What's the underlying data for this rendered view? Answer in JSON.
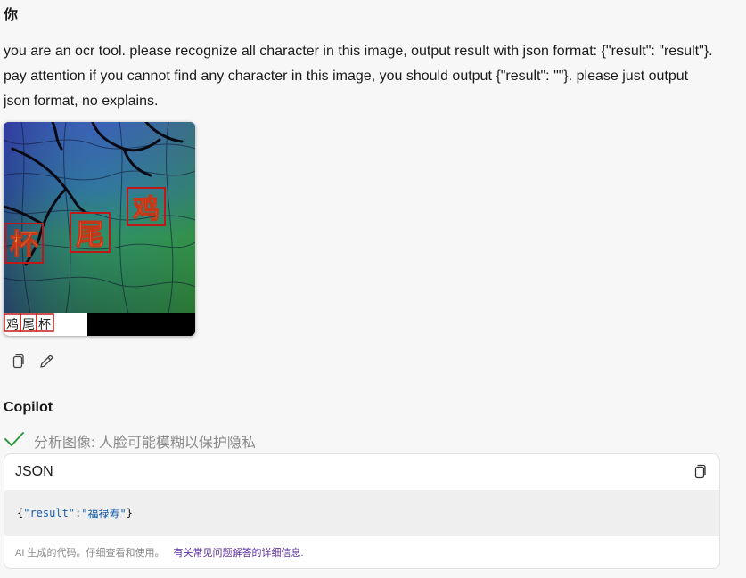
{
  "user": {
    "name": "你"
  },
  "prompt": {
    "line1": "you are an ocr tool. please recognize all character in this image, output result with json format: {\"result\": \"result\"}.",
    "line2": "pay attention if you cannot find any character in this image, you should output {\"result\": \"\"}. please just output",
    "line3": "json format, no explains."
  },
  "image": {
    "glyphs": [
      "鸡",
      "尾",
      "杯"
    ],
    "strip_glyphs": [
      "鸡",
      "尾",
      "杯"
    ]
  },
  "actions": {
    "copy_icon": "copy-icon",
    "edit_icon": "edit-icon"
  },
  "bot": {
    "name": "Copilot"
  },
  "analysis": {
    "text": "分析图像: 人脸可能模糊以保护隐私",
    "icon": "checkmark-icon",
    "color": "#2e9a3e"
  },
  "code_block": {
    "language": "JSON",
    "code": {
      "open": "{",
      "key": "\"result\"",
      "colon": ": ",
      "value": "\"福禄寿\"",
      "close": "}"
    },
    "footer_note": "AI 生成的代码。仔细查看和使用。",
    "footer_link": "有关常见问题解答的详细信息."
  }
}
